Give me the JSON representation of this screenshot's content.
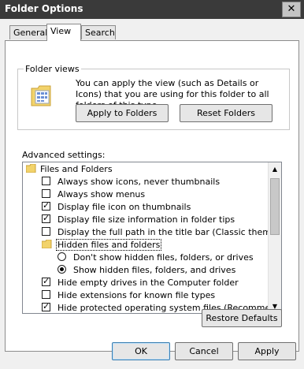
{
  "window": {
    "title": "Folder Options",
    "close_glyph": "✕"
  },
  "tabs": [
    {
      "label": "General"
    },
    {
      "label": "View"
    },
    {
      "label": "Search"
    }
  ],
  "folder_views": {
    "label": "Folder views",
    "description": "You can apply the view (such as Details or Icons) that you are using for this folder to all folders of this type.",
    "apply_button": "Apply to Folders",
    "reset_button": "Reset Folders"
  },
  "advanced": {
    "label": "Advanced settings:",
    "items": [
      {
        "kind": "folder",
        "label": "Files and Folders"
      },
      {
        "kind": "checkbox",
        "label": "Always show icons, never thumbnails",
        "checked": false
      },
      {
        "kind": "checkbox",
        "label": "Always show menus",
        "checked": false
      },
      {
        "kind": "checkbox",
        "label": "Display file icon on thumbnails",
        "checked": true
      },
      {
        "kind": "checkbox",
        "label": "Display file size information in folder tips",
        "checked": true
      },
      {
        "kind": "checkbox",
        "label": "Display the full path in the title bar (Classic theme only)",
        "checked": false
      },
      {
        "kind": "folder",
        "label": "Hidden files and folders",
        "selected": true
      },
      {
        "kind": "radio",
        "label": "Don't show hidden files, folders, or drives",
        "checked": false
      },
      {
        "kind": "radio",
        "label": "Show hidden files, folders, and drives",
        "checked": true
      },
      {
        "kind": "checkbox",
        "label": "Hide empty drives in the Computer folder",
        "checked": true
      },
      {
        "kind": "checkbox",
        "label": "Hide extensions for known file types",
        "checked": false
      },
      {
        "kind": "checkbox",
        "label": "Hide protected operating system files (Recommended)",
        "checked": true
      }
    ],
    "restore_button": "Restore Defaults"
  },
  "footer": {
    "ok": "OK",
    "cancel": "Cancel",
    "apply": "Apply"
  }
}
